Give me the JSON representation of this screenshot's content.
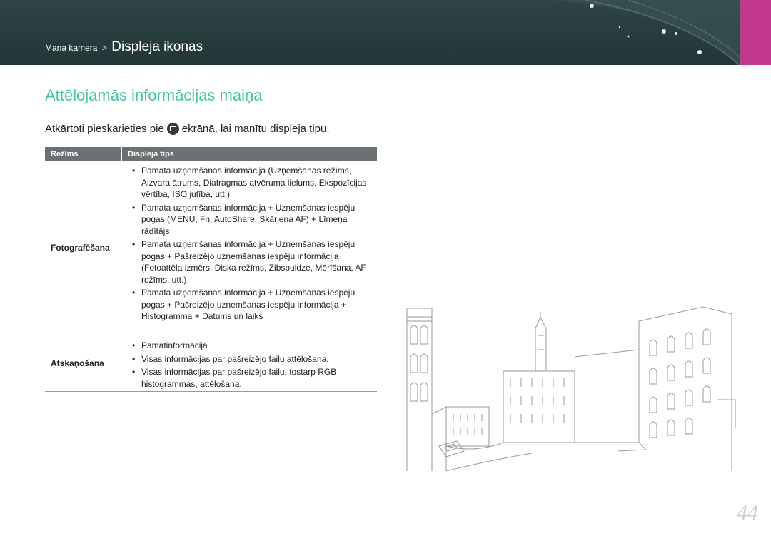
{
  "header": {
    "breadcrumb_parent": "Mana kamera",
    "breadcrumb_separator": ">",
    "breadcrumb_current": "Displeja ikonas",
    "accent_color": "#c2388d",
    "background_color": "#2f4446"
  },
  "title": "Attēlojamās informācijas maiņa",
  "title_color": "#3fc4a6",
  "instruction": {
    "before": "Atkārtoti pieskarieties pie",
    "icon": "display-button-icon",
    "after": "ekrānā, lai manītu displeja tipu."
  },
  "table": {
    "headers": [
      "Režīms",
      "Displeja tips"
    ],
    "rows": [
      {
        "mode": "Fotografēšana",
        "items": [
          "Pamata uzņemšanas informācija (Uzņemšanas režīms, Aizvara ātrums, Diafragmas atvēruma lielums, Ekspozīcijas vērtība, ISO jutība, utt.)",
          "Pamata uzņemšanas informācija + Uzņemšanas iespēju pogas (MENU, Fn, AutoShare, Skāriena AF) + Līmeņa rādītājs",
          "Pamata uzņemšanas informācija + Uzņemšanas iespēju pogas + Pašreizējo uzņemšanas iespēju informācija (Fotoattēla izmērs, Diska režīms, Zibspuldze, Mērīšana, AF režīms, utt.)",
          "Pamata uzņemšanas informācija + Uzņemšanas iespēju pogas + Pašreizējo uzņemšanas iespēju informācija + Histogramma + Datums un laiks"
        ]
      },
      {
        "mode": "Atskaņošana",
        "items": [
          "Pamatinformācija",
          "Visas informācijas par pašreizējo failu attēlošana.",
          "Visas informācijas par pašreizējo failu, tostarp RGB histogrammas, attēlošana."
        ]
      }
    ]
  },
  "page_number": "44"
}
